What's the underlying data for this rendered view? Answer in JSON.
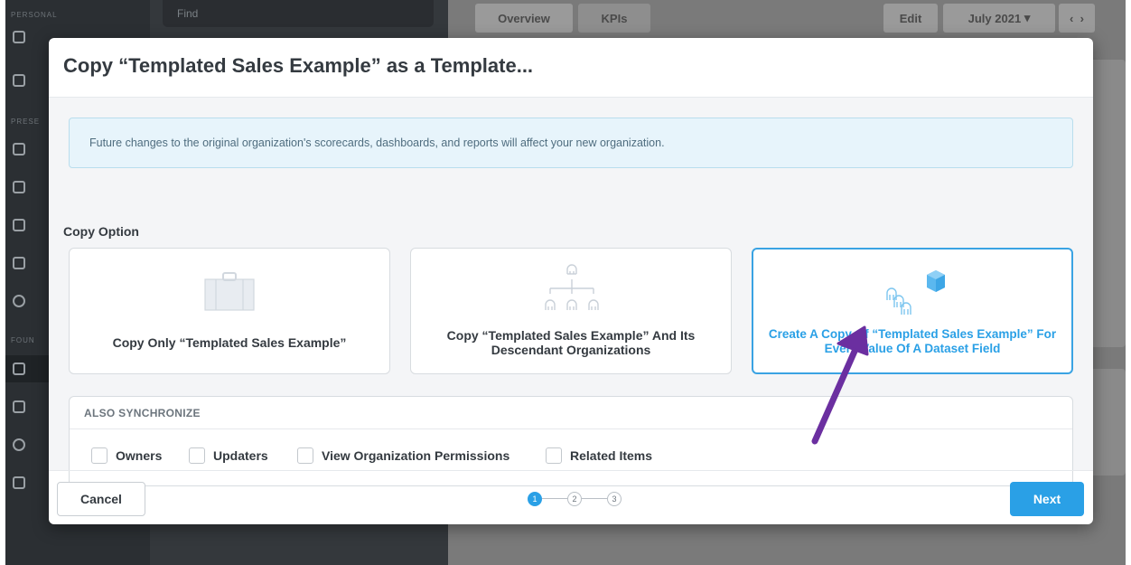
{
  "background": {
    "sidebar_sections": [
      "PERSONAL",
      "PRESE",
      "FOUN"
    ],
    "search_placeholder": "Find",
    "tabs": [
      "Overview",
      "KPIs",
      "Edit"
    ],
    "date": "July 2021",
    "date_caret": "▾",
    "prev": "‹",
    "next": "›"
  },
  "modal": {
    "title": "Copy “Templated Sales Example” as a Template...",
    "info": "Future changes to the original organization's scorecards, dashboards, and reports will affect your new organization.",
    "copy_option_label": "Copy Option",
    "cards": [
      {
        "label": "Copy Only “Templated Sales Example”",
        "icon": "briefcase-icon",
        "selected": false
      },
      {
        "label": "Copy “Templated Sales Example” And Its Descendant Organizations",
        "icon": "org-tree-icon",
        "selected": false
      },
      {
        "label": "Create A Copy Of “Templated Sales Example” For Every Value Of A Dataset Field",
        "icon": "dataset-copy-icon",
        "selected": true
      }
    ],
    "also_synchronize": "ALSO SYNCHRONIZE",
    "sync_options": [
      "Owners",
      "Updaters",
      "View Organization Permissions",
      "Related Items"
    ],
    "cancel": "Cancel",
    "next": "Next",
    "steps": [
      "1",
      "2",
      "3"
    ],
    "current_step": 1
  },
  "colors": {
    "accent": "#2aa0e6",
    "arrow": "#6b2fa0",
    "info_bg": "#e7f4fb"
  }
}
